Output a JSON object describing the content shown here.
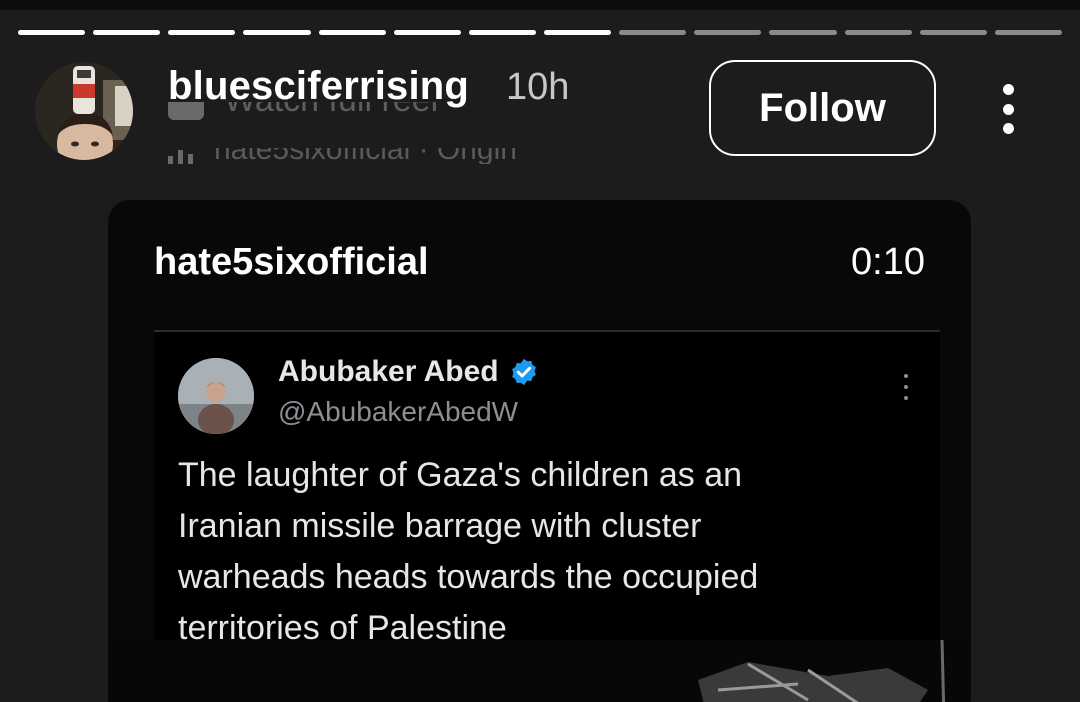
{
  "story": {
    "segments_total": 14,
    "segments_seen": 8
  },
  "header": {
    "username": "bluesciferrising",
    "time_ago": "10h",
    "follow_label": "Follow",
    "overlap_line1": "Watch full reel",
    "overlap_line2": "hate5sixofficial · Origin"
  },
  "reel": {
    "account": "hate5sixofficial",
    "duration": "0:10"
  },
  "tweet": {
    "display_name": "Abubaker Abed",
    "handle": "@AbubakerAbedW",
    "verified_color": "#1d9bf0",
    "lines": [
      "The laughter of Gaza's children as an",
      "Iranian missile barrage with cluster",
      "warheads heads towards the occupied",
      "territories of Palestine"
    ]
  },
  "icons": {
    "more": "vertical-ellipsis-icon",
    "verified": "verified-badge-icon"
  }
}
